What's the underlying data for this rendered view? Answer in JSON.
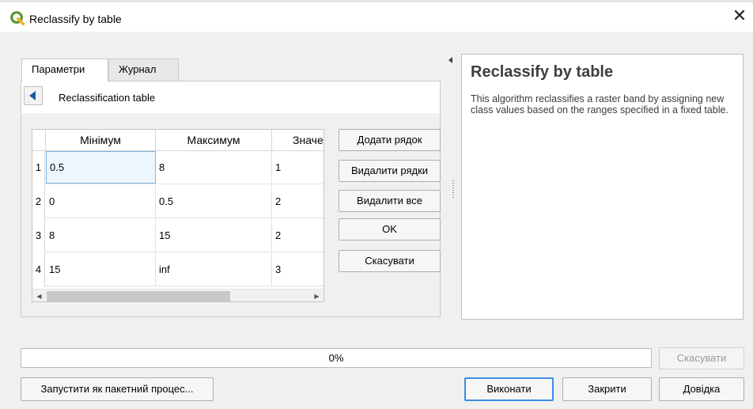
{
  "window": {
    "title": "Reclassify by table",
    "close_glyph": "✕"
  },
  "tabs": [
    {
      "label": "Параметри",
      "active": true
    },
    {
      "label": "Журнал",
      "active": false
    }
  ],
  "breadcrumb": {
    "label": "Reclassification table"
  },
  "table": {
    "columns": [
      "Мінімум",
      "Максимум",
      "Значення"
    ],
    "rows": [
      {
        "num": "1",
        "cells": [
          "0.5",
          "8",
          "1"
        ]
      },
      {
        "num": "2",
        "cells": [
          "0",
          "0.5",
          "2"
        ]
      },
      {
        "num": "3",
        "cells": [
          "8",
          "15",
          "2"
        ]
      },
      {
        "num": "4",
        "cells": [
          "15",
          "inf",
          "3"
        ]
      }
    ]
  },
  "table_buttons": {
    "add_row": "Додати рядок",
    "remove_rows": "Видалити рядки",
    "remove_all": "Видалити все",
    "ok": "OK",
    "cancel": "Скасувати"
  },
  "help": {
    "title": "Reclassify by table",
    "body": "This algorithm reclassifies a raster band by assigning new class values based on the ranges specified in a fixed table."
  },
  "progress": {
    "text": "0%",
    "value": 0
  },
  "footer": {
    "cancel": "Скасувати",
    "batch": "Запустити як пакетний процес...",
    "run": "Виконати",
    "close": "Закрити",
    "help": "Довідка"
  },
  "colors": {
    "qgis_green": "#589632",
    "qgis_yellow": "#f0b31b",
    "focus_blue": "#3a8ee6"
  }
}
